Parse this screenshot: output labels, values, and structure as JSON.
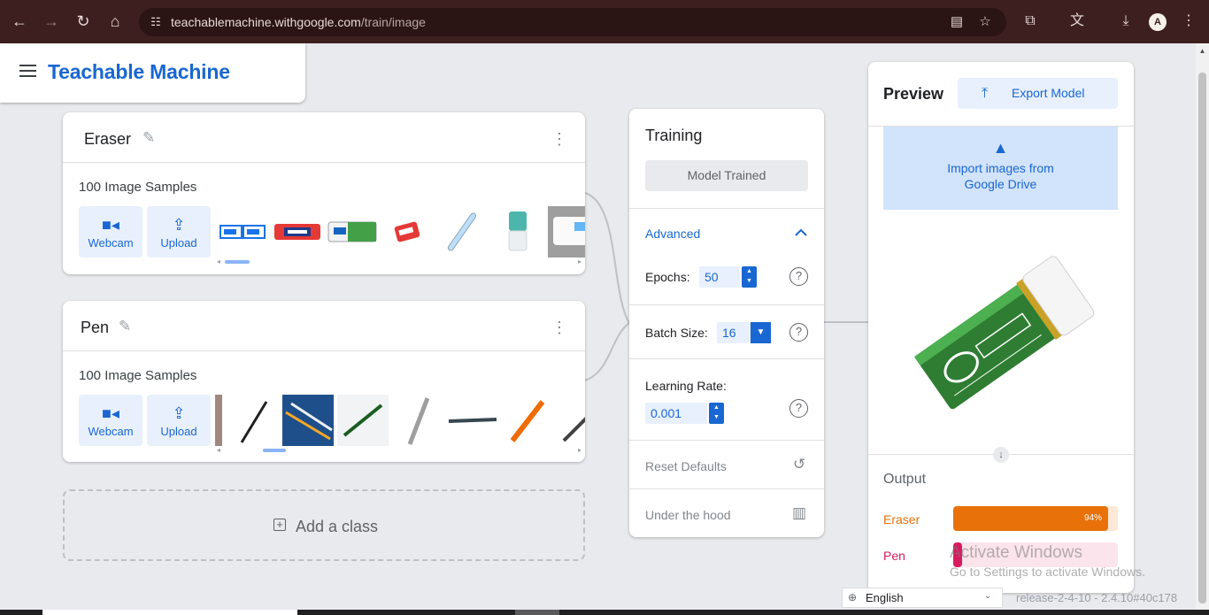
{
  "browser": {
    "url_host": "teachablemachine.withgoogle.com",
    "url_path": "/train/image",
    "profile_initial": "A"
  },
  "header": {
    "title": "Teachable Machine"
  },
  "classes": [
    {
      "name": "Eraser",
      "samples": "100 Image Samples",
      "webcam_label": "Webcam",
      "upload_label": "Upload"
    },
    {
      "name": "Pen",
      "samples": "100 Image Samples",
      "webcam_label": "Webcam",
      "upload_label": "Upload"
    }
  ],
  "add_class": {
    "label": "Add a class"
  },
  "training": {
    "title": "Training",
    "button_label": "Model Trained",
    "advanced_label": "Advanced",
    "epochs_label": "Epochs:",
    "epochs_value": "50",
    "batch_label": "Batch Size:",
    "batch_value": "16",
    "lr_label": "Learning Rate:",
    "lr_value": "0.001",
    "reset_label": "Reset Defaults",
    "hood_label": "Under the hood"
  },
  "preview": {
    "title": "Preview",
    "export_label": "Export Model",
    "drive_line1": "Import images from",
    "drive_line2": "Google Drive",
    "output_title": "Output",
    "outputs": [
      {
        "label": "Eraser",
        "percent_text": "94%",
        "value": 0.94,
        "color": "#e8710a",
        "track": "#fce8d6"
      },
      {
        "label": "Pen",
        "percent_text": "",
        "value": 0.03,
        "color": "#d81b60",
        "track": "#fce4ec"
      }
    ]
  },
  "footer": {
    "language": "English",
    "release": "release-2-4-10 - 2.4.10#40c178"
  },
  "watermark": {
    "line1": "Activate Windows",
    "line2": "Go to Settings to activate Windows."
  },
  "colors": {
    "accent": "#1967d2",
    "eraser": "#e8710a",
    "pen": "#d81b60"
  }
}
